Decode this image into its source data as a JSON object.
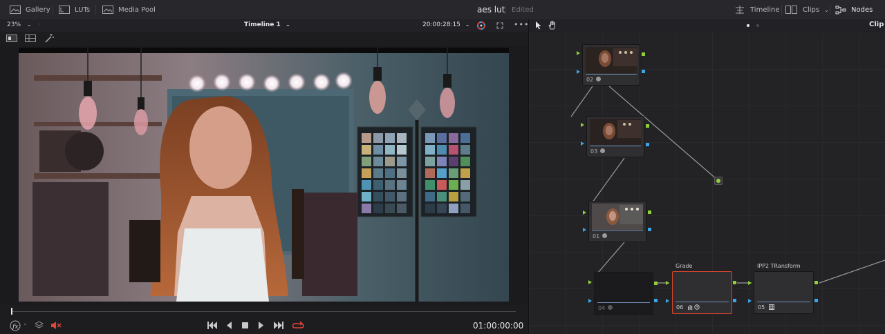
{
  "topbar": {
    "gallery_label": "Gallery",
    "luts_label": "LUTs",
    "media_pool_label": "Media Pool",
    "project_title": "aes lut",
    "project_status": "Edited",
    "timeline_label": "Timeline",
    "clips_label": "Clips",
    "nodes_label": "Nodes"
  },
  "viewer": {
    "zoom": "23%",
    "timeline_name": "Timeline 1",
    "timecode": "20:00:28:15",
    "playhead_timecode": "01:00:00:00"
  },
  "nodepanel": {
    "mode_label": "Clip"
  },
  "nodes": [
    {
      "number": "02",
      "label": ""
    },
    {
      "number": "03",
      "label": ""
    },
    {
      "number": "01",
      "label": ""
    },
    {
      "number": "04",
      "label": ""
    },
    {
      "number": "06",
      "label": "Grade"
    },
    {
      "number": "05",
      "label": "IPP2 TRansform"
    }
  ],
  "colors": {
    "accent_green": "#8fd13a",
    "accent_blue": "#3aa5e8",
    "selected_node": "#d9452e",
    "loop_active": "#e0443a"
  }
}
